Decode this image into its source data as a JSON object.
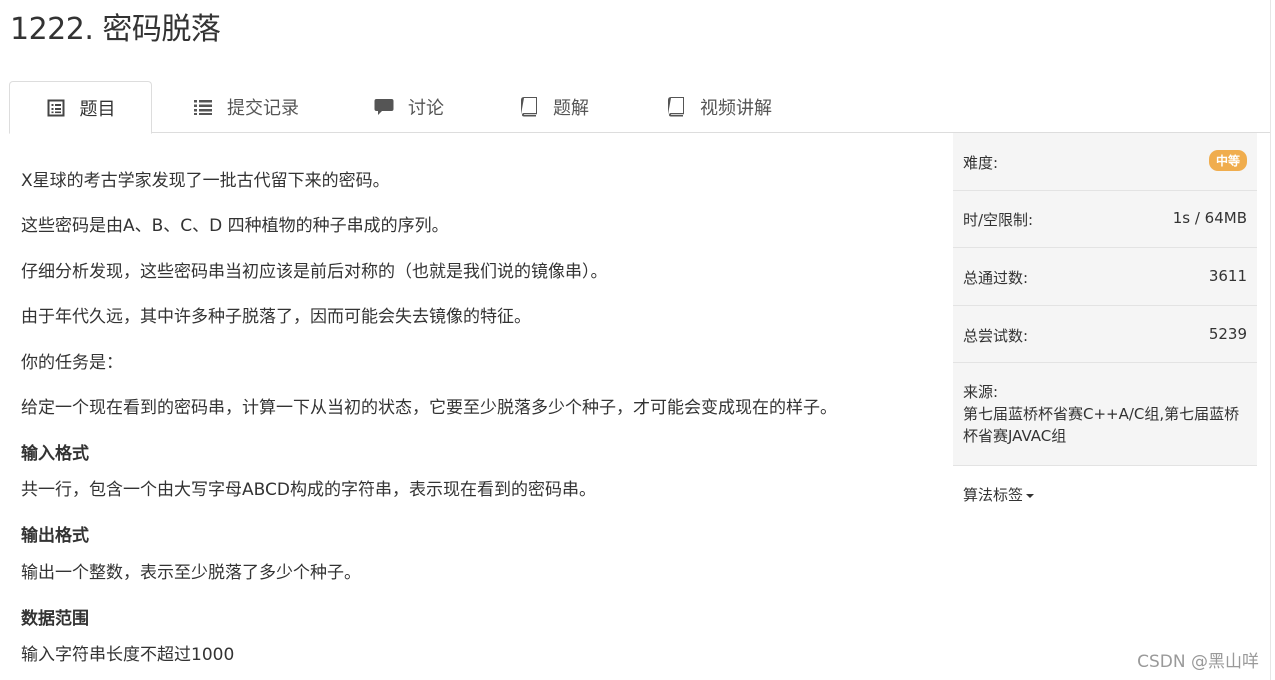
{
  "problem": {
    "title": "1222. 密码脱落"
  },
  "tabs": [
    {
      "label": "题目",
      "icon": "description-icon"
    },
    {
      "label": "提交记录",
      "icon": "list-icon"
    },
    {
      "label": "讨论",
      "icon": "comment-icon"
    },
    {
      "label": "题解",
      "icon": "book-icon"
    },
    {
      "label": "视频讲解",
      "icon": "book-icon"
    }
  ],
  "content": {
    "paragraphs": [
      "X星球的考古学家发现了一批古代留下来的密码。",
      "这些密码是由A、B、C、D 四种植物的种子串成的序列。",
      "仔细分析发现，这些密码串当初应该是前后对称的（也就是我们说的镜像串）。",
      "由于年代久远，其中许多种子脱落了，因而可能会失去镜像的特征。",
      "你的任务是：",
      "给定一个现在看到的密码串，计算一下从当初的状态，它要至少脱落多少个种子，才可能会变成现在的样子。"
    ],
    "input_heading": "输入格式",
    "input_text": "共一行，包含一个由大写字母ABCD构成的字符串，表示现在看到的密码串。",
    "output_heading": "输出格式",
    "output_text": "输出一个整数，表示至少脱落了多少个种子。",
    "range_heading": "数据范围",
    "range_text": "输入字符串长度不超过1000"
  },
  "sidebar": {
    "difficulty_label": "难度:",
    "difficulty_value": "中等",
    "limit_label": "时/空限制:",
    "limit_value": "1s / 64MB",
    "passed_label": "总通过数:",
    "passed_value": "3611",
    "tried_label": "总尝试数:",
    "tried_value": "5239",
    "source_label": "来源:",
    "source_value": "第七届蓝桥杯省赛C++A/C组,第七届蓝桥杯省赛JAVAC组",
    "tags_label": "算法标签"
  },
  "colors": {
    "badge": "#f0ad4e",
    "sidebar_bg": "#f5f5f5"
  },
  "watermark": "CSDN @黑山咩"
}
